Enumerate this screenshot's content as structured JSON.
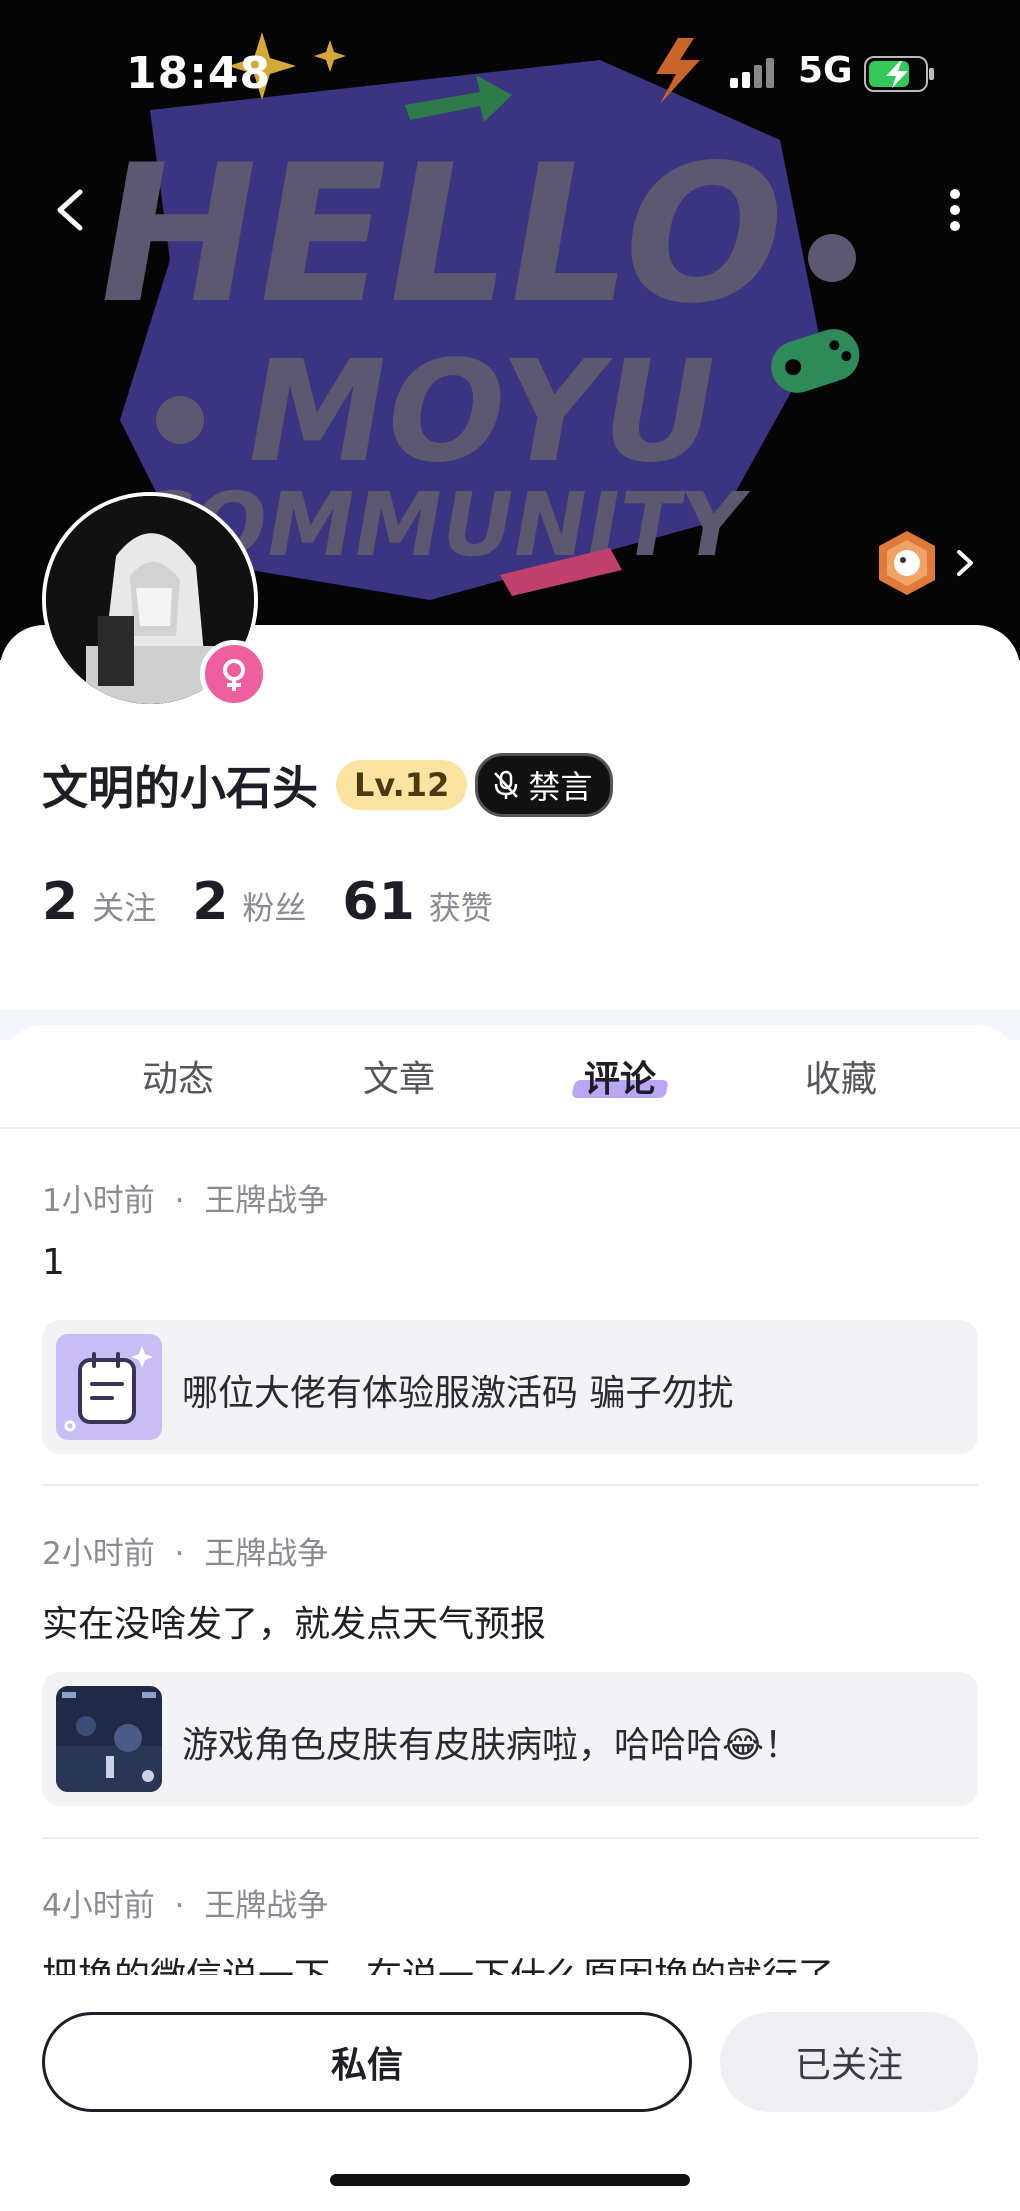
{
  "status_bar": {
    "time": "18:48",
    "network": "5G"
  },
  "banner": {
    "line1": "HELLO",
    "line2": "MOYU",
    "line3": "COMMUNITY",
    "colors": {
      "text": "#5b5870",
      "blob": "#3b3481",
      "arrow": "#2f7a4a",
      "controller": "#2f8a5a",
      "bolt": "#c8652b",
      "star": "#d4a93a"
    }
  },
  "profile": {
    "username": "文明的小石头",
    "level": "Lv.12",
    "muted_label": "禁言",
    "stats": [
      {
        "value": "2",
        "label": "关注"
      },
      {
        "value": "2",
        "label": "粉丝"
      },
      {
        "value": "61",
        "label": "获赞"
      }
    ]
  },
  "tabs": [
    "动态",
    "文章",
    "评论",
    "收藏"
  ],
  "active_tab": "评论",
  "comments": [
    {
      "time": "1小时前",
      "game": "王牌战争",
      "text": "1",
      "ref": "哪位大佬有体验服激活码 骗子勿扰",
      "ref_thumb": "notepad-icon"
    },
    {
      "time": "2小时前",
      "game": "王牌战争",
      "text": "实在没啥发了，就发点天气预报",
      "ref": "游戏角色皮肤有皮肤病啦，哈哈哈😂！",
      "ref_thumb": "game-screenshot"
    },
    {
      "time": "4小时前",
      "game": "王牌战争",
      "text": "把换的微信说一下，在说一下什么原因换的就行了"
    }
  ],
  "meta_separator": "·",
  "actions": {
    "message": "私信",
    "following": "已关注"
  }
}
